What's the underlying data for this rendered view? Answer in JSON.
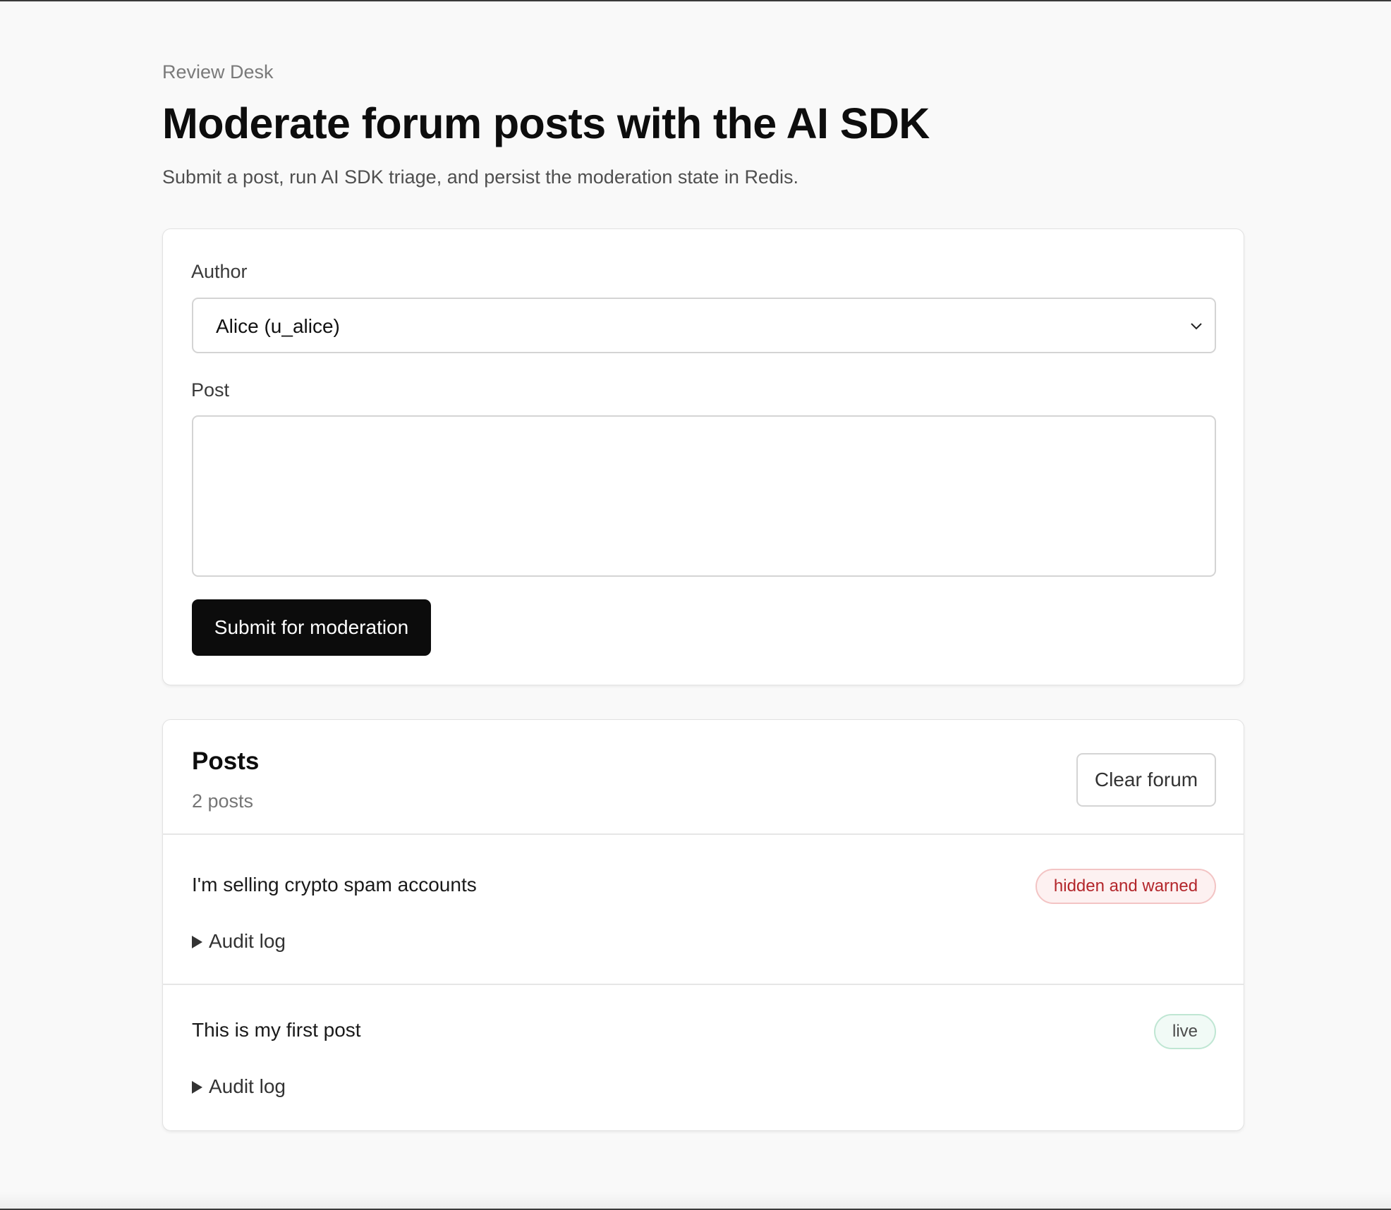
{
  "header": {
    "eyebrow": "Review Desk",
    "title": "Moderate forum posts with the AI SDK",
    "subtitle": "Submit a post, run AI SDK triage, and persist the moderation state in Redis."
  },
  "form": {
    "author_label": "Author",
    "author_selected": "Alice (u_alice)",
    "post_label": "Post",
    "post_value": "",
    "post_placeholder": "",
    "submit_label": "Submit for moderation"
  },
  "posts": {
    "heading": "Posts",
    "count_text": "2 posts",
    "clear_label": "Clear forum",
    "items": [
      {
        "text": "I'm selling crypto spam accounts",
        "status": "hidden and warned",
        "audit_label": "Audit log"
      },
      {
        "text": "This is my first post",
        "status": "live",
        "audit_label": "Audit log"
      }
    ]
  },
  "colors": {
    "background": "#f9f9f9",
    "primary_button": "#0c0c0c",
    "status_hidden_text": "#b3262b",
    "status_hidden_bg": "#fdf1f1",
    "status_live_bg": "#f1faf6",
    "status_live_border": "#bfe6d3"
  },
  "icons": {
    "select_chevron": "chevron-down-icon",
    "audit_toggle": "disclosure-triangle-icon"
  }
}
